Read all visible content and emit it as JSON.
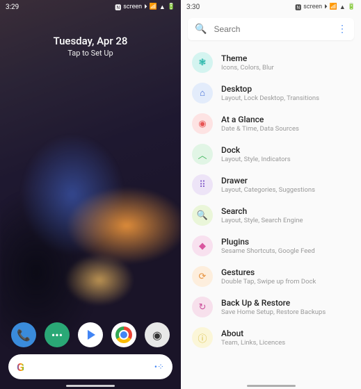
{
  "left": {
    "status": {
      "time": "3:29",
      "icons": [
        "🅽",
        "screen",
        "⏵",
        "📶",
        "▲",
        "🔋"
      ]
    },
    "date": "Tuesday, Apr 28",
    "subtitle": "Tap to Set Up",
    "dock": [
      {
        "name": "phone",
        "glyph": "📞"
      },
      {
        "name": "messages",
        "glyph": "•••"
      },
      {
        "name": "play-store",
        "glyph": ""
      },
      {
        "name": "chrome",
        "glyph": ""
      },
      {
        "name": "camera",
        "glyph": "◉"
      }
    ],
    "searchbar": {
      "logo": "G",
      "assistant": "•⁘"
    }
  },
  "right": {
    "status": {
      "time": "3:30",
      "icons": [
        "🅽",
        "screen",
        "⏵",
        "📶",
        "▲",
        "🔋"
      ]
    },
    "search": {
      "placeholder": "Search"
    },
    "settings": [
      {
        "title": "Theme",
        "sub": "Icons, Colors, Blur",
        "color": "c-teal",
        "glyph": "❃"
      },
      {
        "title": "Desktop",
        "sub": "Layout, Lock Desktop, Transitions",
        "color": "c-blue",
        "glyph": "⌂"
      },
      {
        "title": "At a Glance",
        "sub": "Date & Time, Data Sources",
        "color": "c-red",
        "glyph": "◉"
      },
      {
        "title": "Dock",
        "sub": "Layout, Style, Indicators",
        "color": "c-green",
        "glyph": "︿"
      },
      {
        "title": "Drawer",
        "sub": "Layout, Categories, Suggestions",
        "color": "c-purple",
        "glyph": "⠿"
      },
      {
        "title": "Search",
        "sub": "Layout, Style, Search Engine",
        "color": "c-lime",
        "glyph": "🔍"
      },
      {
        "title": "Plugins",
        "sub": "Sesame Shortcuts, Google Feed",
        "color": "c-pink",
        "glyph": "◆"
      },
      {
        "title": "Gestures",
        "sub": "Double Tap, Swipe up from Dock",
        "color": "c-orange",
        "glyph": "⟳"
      },
      {
        "title": "Back Up & Restore",
        "sub": "Save Home Setup, Restore Backups",
        "color": "c-magenta",
        "glyph": "↻"
      },
      {
        "title": "About",
        "sub": "Team, Links, Licences",
        "color": "c-yellow",
        "glyph": "ⓘ"
      }
    ]
  }
}
